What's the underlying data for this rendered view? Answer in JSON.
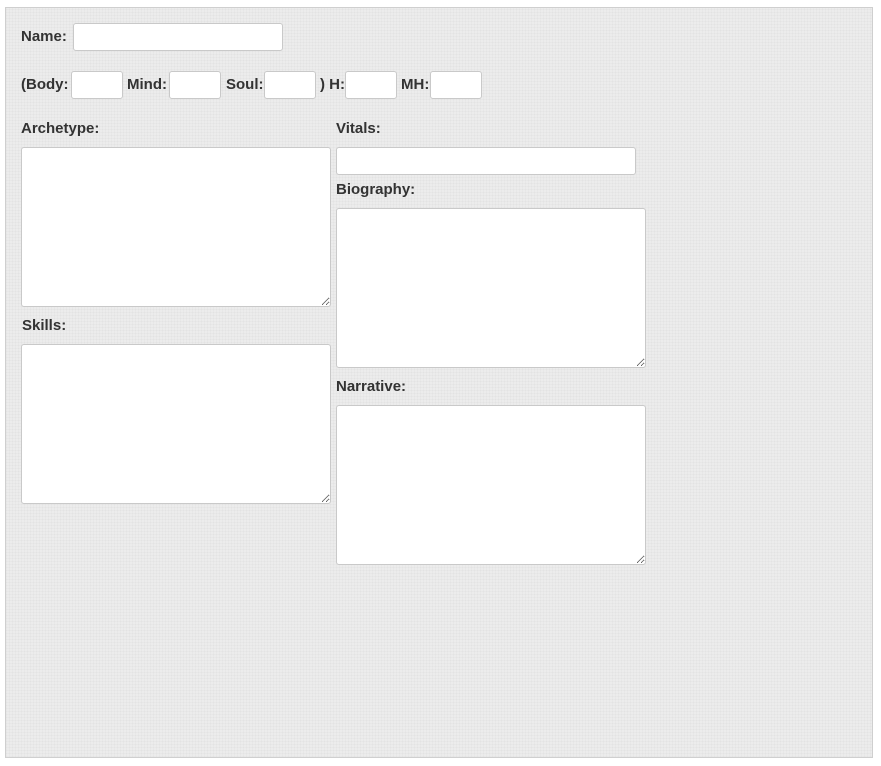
{
  "form": {
    "name": {
      "label": "Name:",
      "value": ""
    },
    "stats": {
      "open_paren_body_label": "(Body:",
      "body_value": "",
      "mind_label": "Mind:",
      "mind_value": "",
      "soul_label": "Soul:",
      "soul_value": "",
      "close_paren_h_label": ") H:",
      "h_value": "",
      "mh_label": "MH:",
      "mh_value": ""
    },
    "archetype": {
      "label": "Archetype:",
      "value": ""
    },
    "skills": {
      "label": "Skills:",
      "value": ""
    },
    "vitals": {
      "label": "Vitals:",
      "value": ""
    },
    "biography": {
      "label": "Biography:",
      "value": ""
    },
    "narrative": {
      "label": "Narrative:",
      "value": ""
    }
  },
  "colors": {
    "background": "#ececec",
    "field_background": "#ffffff",
    "field_border": "#c9c9c9",
    "label_text": "#333333"
  }
}
